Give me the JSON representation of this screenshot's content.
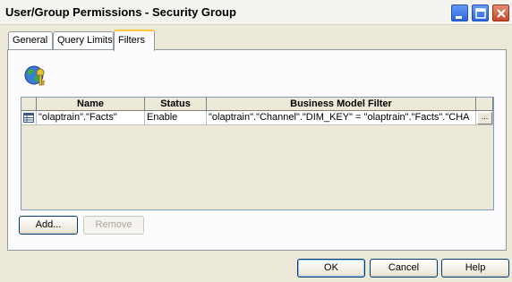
{
  "window": {
    "title": "User/Group Permissions - Security Group"
  },
  "titlebar_buttons": [
    "minimize-icon",
    "maximize-icon",
    "close-icon"
  ],
  "tabs": [
    {
      "label": "General",
      "active": false
    },
    {
      "label": "Query Limits",
      "active": false
    },
    {
      "label": "Filters",
      "active": true
    }
  ],
  "filters": {
    "icon": "globe-key-icon",
    "columns": [
      "",
      "Name",
      "Status",
      "Business Model Filter",
      ""
    ],
    "rows": [
      {
        "name": "\"olaptrain\".\"Facts\"",
        "status": "Enable",
        "business_model_filter": "\"olaptrain\".\"Channel\".\"DIM_KEY\" = \"olaptrain\".\"Facts\".\"CHA",
        "edit": "..."
      }
    ],
    "add_label": "Add...",
    "remove_label": "Remove"
  },
  "footer": {
    "ok_label": "OK",
    "cancel_label": "Cancel",
    "help_label": "Help"
  },
  "colors": {
    "dialog_bg": "#ece9d8",
    "panel_bg": "#fcfcfe",
    "active_tab_highlight": "#ffc83c",
    "titlebar_button": "#2a63dc",
    "close_button": "#c2472a"
  }
}
